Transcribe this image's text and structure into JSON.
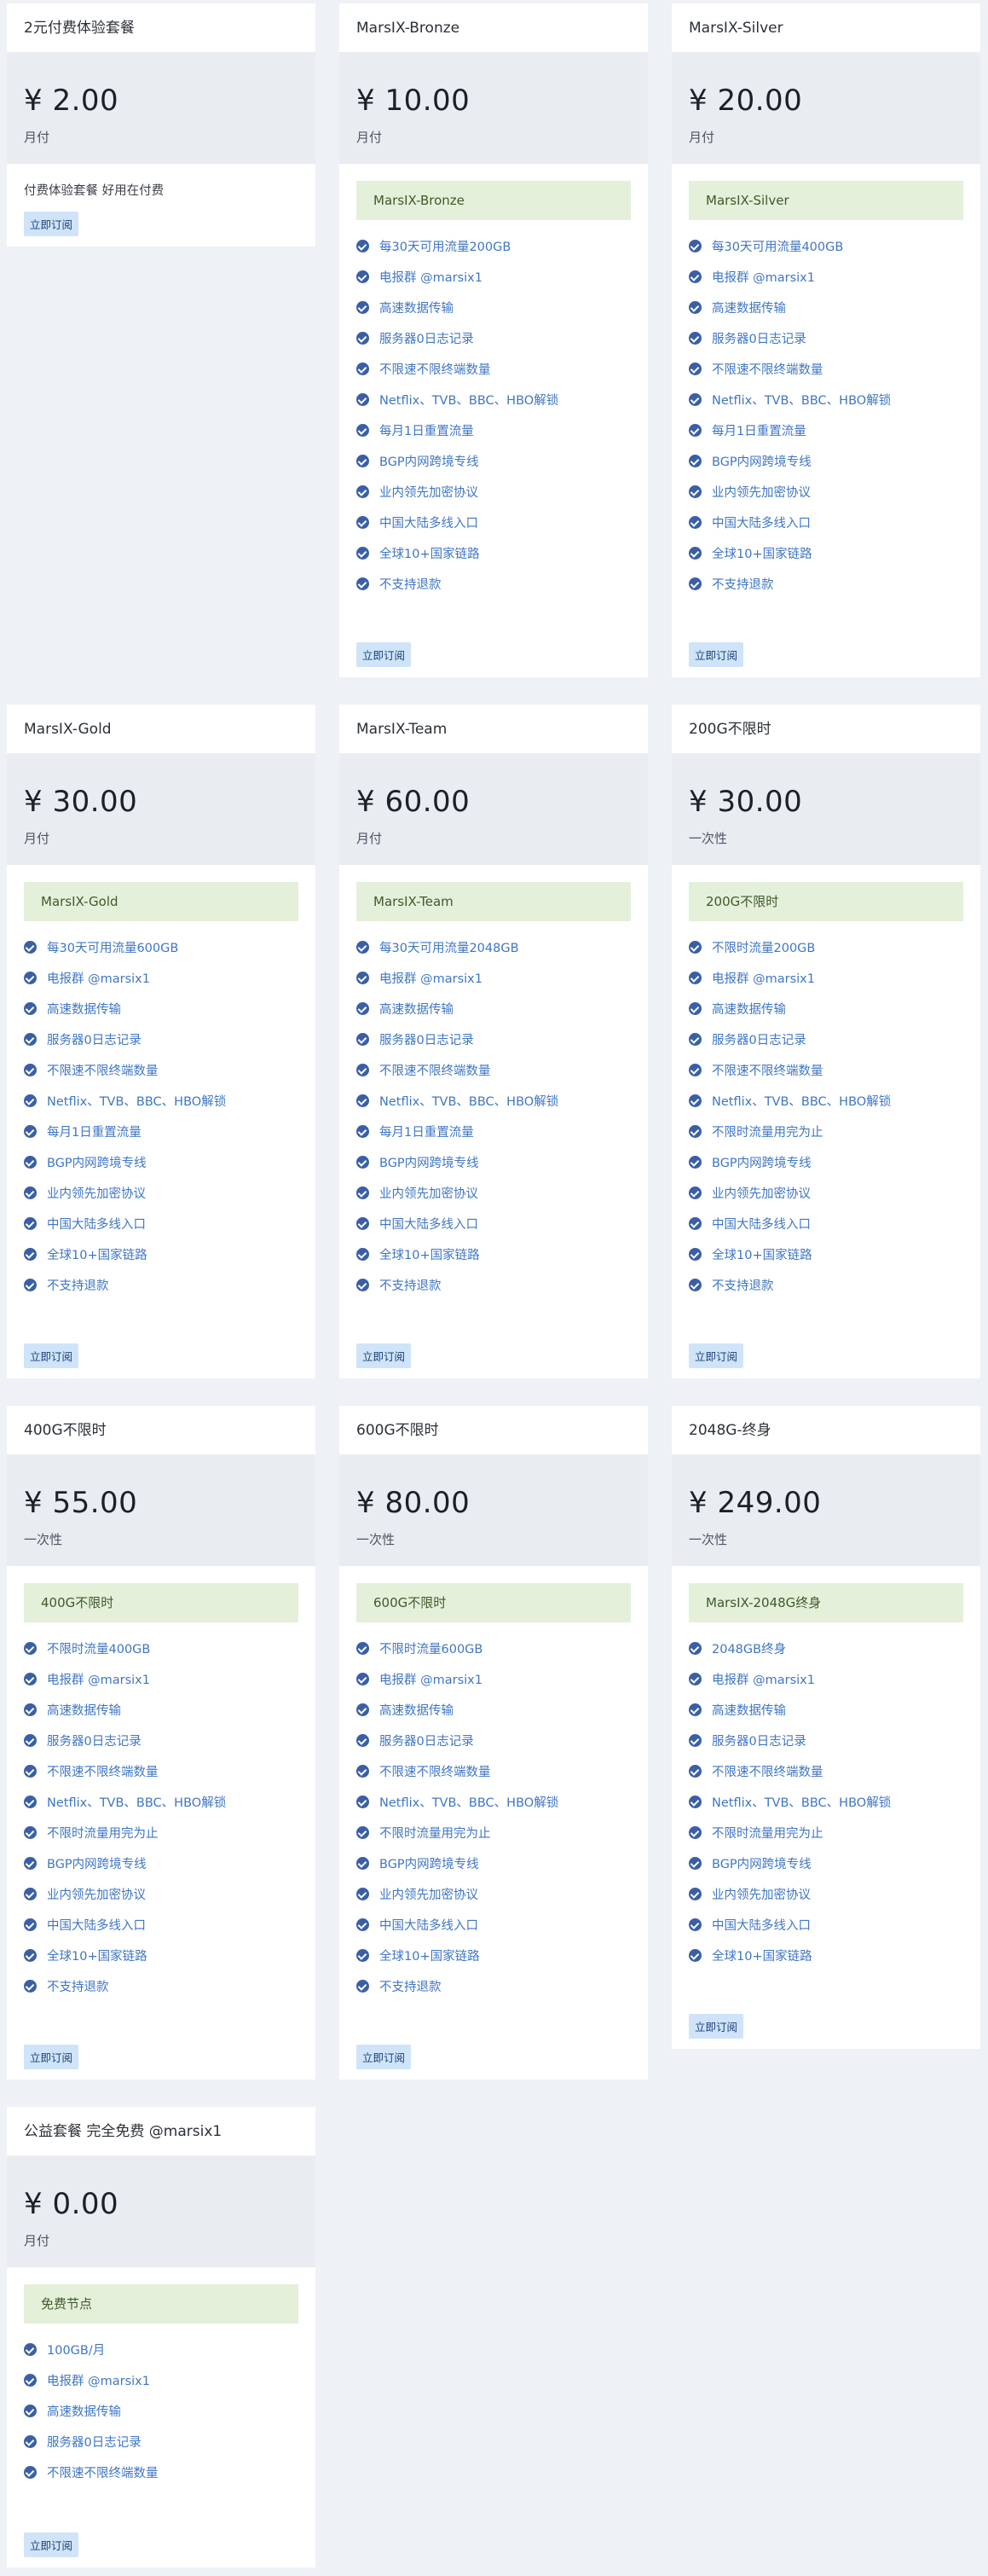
{
  "plans": [
    {
      "title": "2元付费体验套餐",
      "price": "¥ 2.00",
      "period": "月付",
      "description": "付费体验套餐 好用在付费",
      "tag": "",
      "features": [],
      "button": "立即订阅"
    },
    {
      "title": "MarsIX-Bronze",
      "price": "¥ 10.00",
      "period": "月付",
      "description": "",
      "tag": "MarsIX-Bronze",
      "features": [
        "每30天可用流量200GB",
        "电报群 @marsix1",
        "高速数据传输",
        "服务器0日志记录",
        "不限速不限终端数量",
        "Netflix、TVB、BBC、HBO解锁",
        "每月1日重置流量",
        "BGP内网跨境专线",
        "业内领先加密协议",
        " 中国大陆多线入口",
        " 全球10+国家链路",
        " 不支持退款"
      ],
      "button": "立即订阅"
    },
    {
      "title": "MarsIX-Silver",
      "price": "¥ 20.00",
      "period": "月付",
      "description": "",
      "tag": "MarsIX-Silver",
      "features": [
        "每30天可用流量400GB",
        "电报群 @marsix1",
        "高速数据传输",
        "服务器0日志记录",
        "不限速不限终端数量",
        "Netflix、TVB、BBC、HBO解锁",
        "每月1日重置流量",
        "BGP内网跨境专线",
        "业内领先加密协议",
        " 中国大陆多线入口",
        " 全球10+国家链路",
        " 不支持退款"
      ],
      "button": "立即订阅"
    },
    {
      "title": "MarsIX-Gold",
      "price": "¥ 30.00",
      "period": "月付",
      "description": "",
      "tag": "MarsIX-Gold",
      "features": [
        "每30天可用流量600GB",
        "电报群 @marsix1",
        "高速数据传输",
        "服务器0日志记录",
        "不限速不限终端数量",
        "Netflix、TVB、BBC、HBO解锁",
        "每月1日重置流量",
        "BGP内网跨境专线",
        "业内领先加密协议",
        " 中国大陆多线入口",
        " 全球10+国家链路",
        " 不支持退款"
      ],
      "button": "立即订阅"
    },
    {
      "title": "MarsIX-Team",
      "price": "¥ 60.00",
      "period": "月付",
      "description": "",
      "tag": "MarsIX-Team",
      "features": [
        "每30天可用流量2048GB",
        "电报群 @marsix1",
        "高速数据传输",
        "服务器0日志记录",
        "不限速不限终端数量",
        "Netflix、TVB、BBC、HBO解锁",
        "每月1日重置流量",
        "BGP内网跨境专线",
        "业内领先加密协议",
        " 中国大陆多线入口",
        " 全球10+国家链路",
        " 不支持退款"
      ],
      "button": "立即订阅"
    },
    {
      "title": "200G不限时",
      "price": "¥ 30.00",
      "period": "一次性",
      "description": "",
      "tag": "200G不限时",
      "features": [
        "不限时流量200GB",
        "电报群 @marsix1",
        "高速数据传输",
        "服务器0日志记录",
        "不限速不限终端数量",
        "Netflix、TVB、BBC、HBO解锁",
        "不限时流量用完为止",
        "BGP内网跨境专线",
        "业内领先加密协议",
        " 中国大陆多线入口",
        " 全球10+国家链路",
        " 不支持退款"
      ],
      "button": "立即订阅"
    },
    {
      "title": "400G不限时",
      "price": "¥ 55.00",
      "period": "一次性",
      "description": "",
      "tag": "400G不限时",
      "features": [
        "不限时流量400GB",
        "电报群 @marsix1",
        "高速数据传输",
        "服务器0日志记录",
        "不限速不限终端数量",
        "Netflix、TVB、BBC、HBO解锁",
        "不限时流量用完为止",
        "BGP内网跨境专线",
        "业内领先加密协议",
        " 中国大陆多线入口",
        " 全球10+国家链路",
        " 不支持退款"
      ],
      "button": "立即订阅"
    },
    {
      "title": "600G不限时",
      "price": "¥ 80.00",
      "period": "一次性",
      "description": "",
      "tag": "600G不限时",
      "features": [
        "不限时流量600GB",
        "电报群 @marsix1",
        "高速数据传输",
        "服务器0日志记录",
        "不限速不限终端数量",
        "Netflix、TVB、BBC、HBO解锁",
        "不限时流量用完为止",
        "BGP内网跨境专线",
        "业内领先加密协议",
        " 中国大陆多线入口",
        " 全球10+国家链路",
        " 不支持退款"
      ],
      "button": "立即订阅"
    },
    {
      "title": "2048G-终身",
      "price": "¥ 249.00",
      "period": "一次性",
      "description": "",
      "tag": "MarsIX-2048G终身",
      "features": [
        "2048GB终身",
        "电报群 @marsix1",
        "高速数据传输",
        "服务器0日志记录",
        "不限速不限终端数量",
        "Netflix、TVB、BBC、HBO解锁",
        "不限时流量用完为止",
        "BGP内网跨境专线",
        "业内领先加密协议",
        " 中国大陆多线入口",
        " 全球10+国家链路"
      ],
      "button": "立即订阅"
    },
    {
      "title": "公益套餐 完全免费 @marsix1",
      "price": "¥ 0.00",
      "period": "月付",
      "description": "",
      "tag": "免费节点",
      "features": [
        "100GB/月",
        "电报群 @marsix1",
        "高速数据传输",
        "服务器0日志记录",
        "不限速不限终端数量"
      ],
      "button": "立即订阅"
    }
  ],
  "colors": {
    "page_bg": "#eef1f6",
    "price_bg": "#e9ecf0",
    "tag_bg": "#e5f0db",
    "feature_text": "#3f76c5",
    "check_icon": "#3a5fa8",
    "button_bg": "#cfe4f9"
  }
}
